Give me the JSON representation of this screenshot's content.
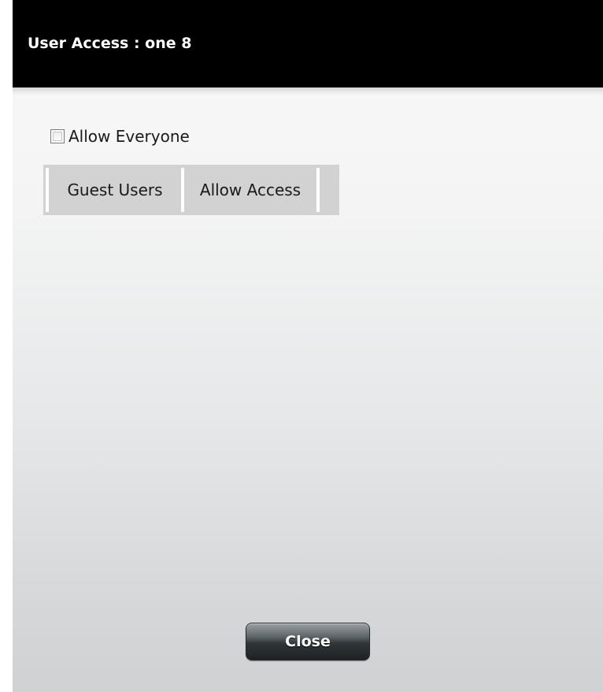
{
  "dialog": {
    "title": "User Access : one 8"
  },
  "allow_everyone": {
    "label": "Allow Everyone",
    "checked": false
  },
  "access_table": {
    "columns": [
      "Guest Users",
      "Allow Access"
    ]
  },
  "footer": {
    "close_label": "Close"
  },
  "colors": {
    "title_bar": "#000000",
    "title_text": "#ffffff",
    "table_header_bg": "#d2d2d2",
    "button_dark": "#2f3538"
  }
}
